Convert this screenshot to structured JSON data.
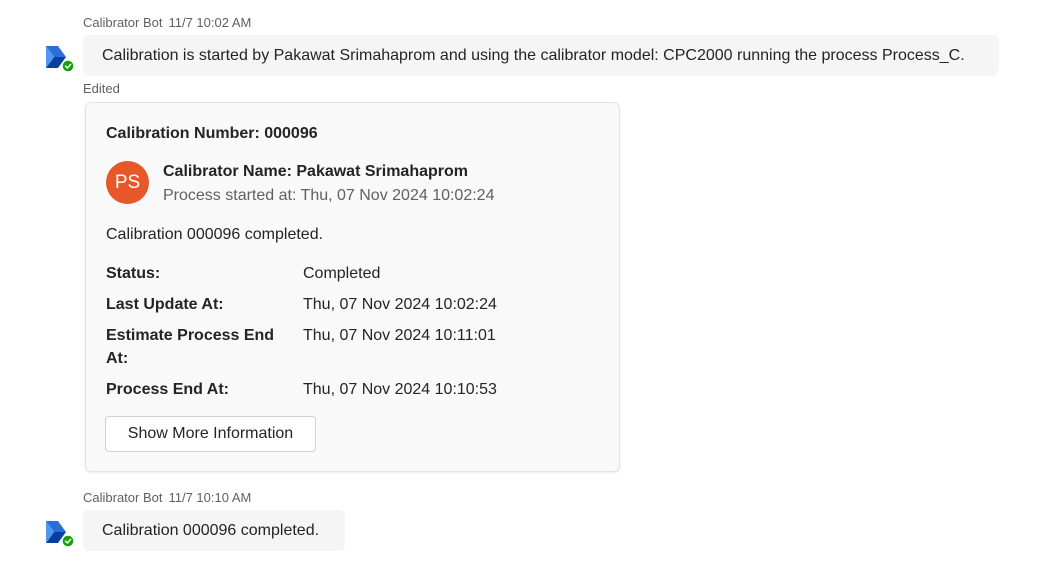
{
  "messages": [
    {
      "sender": "Calibrator Bot",
      "time": "11/7 10:02 AM",
      "text": "Calibration is started by Pakawat Srimahaprom and using the calibrator model: CPC2000 running the process Process_C.",
      "edited_label": "Edited"
    },
    {
      "sender": "Calibrator Bot",
      "time": "11/7 10:10 AM",
      "text": "Calibration 000096 completed."
    }
  ],
  "card": {
    "title": "Calibration Number: 000096",
    "avatar_initials": "PS",
    "calibrator_name": "Calibrator Name: Pakawat Srimahaprom",
    "process_started": "Process started at: Thu, 07 Nov 2024 10:02:24",
    "summary": "Calibration 000096 completed.",
    "facts": [
      {
        "label": "Status:",
        "value": "Completed"
      },
      {
        "label": "Last Update At:",
        "value": "Thu, 07 Nov 2024 10:02:24"
      },
      {
        "label": "Estimate Process End At:",
        "value": "Thu, 07 Nov 2024 10:11:01"
      },
      {
        "label": "Process End At:",
        "value": "Thu, 07 Nov 2024 10:10:53"
      }
    ],
    "action_label": "Show More Information"
  },
  "colors": {
    "avatar_bg": "#e8572a",
    "presence_available": "#13a10e",
    "bubble_bg": "#f5f5f5"
  },
  "icons": {
    "bot_avatar": "power-automate-icon",
    "presence": "available-check-icon"
  }
}
